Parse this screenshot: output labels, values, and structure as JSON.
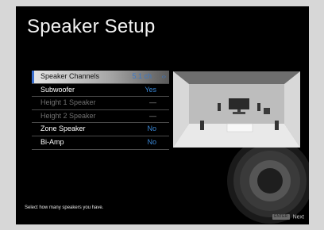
{
  "screen": {
    "title": "Speaker Setup",
    "hint": "Select how many speakers you have.",
    "footer_next": "Next",
    "footer_key": "ENTER"
  },
  "menu": [
    {
      "label": "Speaker Channels",
      "value": "5.1 ch",
      "state": "selected"
    },
    {
      "label": "Subwoofer",
      "value": "Yes",
      "state": "normal"
    },
    {
      "label": "Height 1 Speaker",
      "value": "—",
      "state": "disabled"
    },
    {
      "label": "Height 2 Speaker",
      "value": "—",
      "state": "disabled"
    },
    {
      "label": "Zone Speaker",
      "value": "No",
      "state": "normal"
    },
    {
      "label": "Bi-Amp",
      "value": "No",
      "state": "normal"
    }
  ],
  "preview": {
    "icon": "room-speaker-layout-icon"
  },
  "colors": {
    "accent": "#3a88d8",
    "background": "#000000",
    "frame": "#d7d7d7"
  }
}
